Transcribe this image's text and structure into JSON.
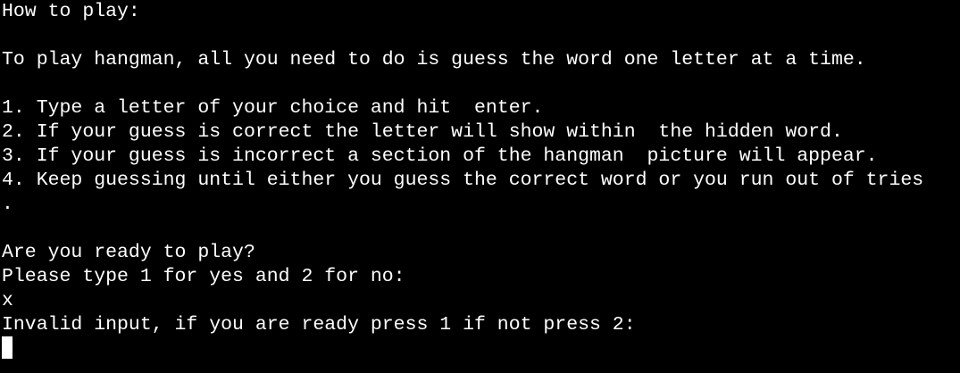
{
  "terminal": {
    "background": "#000000",
    "foreground": "#ffffff",
    "lines": {
      "heading": "How to play:",
      "intro": "To play hangman, all you need to do is guess the word one letter at a time.",
      "rule1": "1. Type a letter of your choice and hit  enter.",
      "rule2": "2. If your guess is correct the letter will show within  the hidden word.",
      "rule3": "3. If your guess is incorrect a section of the hangman  picture will appear.",
      "rule4": "4. Keep guessing until either you guess the correct word or you run out of tries",
      "rule4_wrap": ".",
      "ready_question": "Are you ready to play?",
      "prompt": "Please type 1 for yes and 2 for no:",
      "user_input": "x",
      "error_message": "Invalid input, if you are ready press 1 if not press 2:"
    }
  }
}
